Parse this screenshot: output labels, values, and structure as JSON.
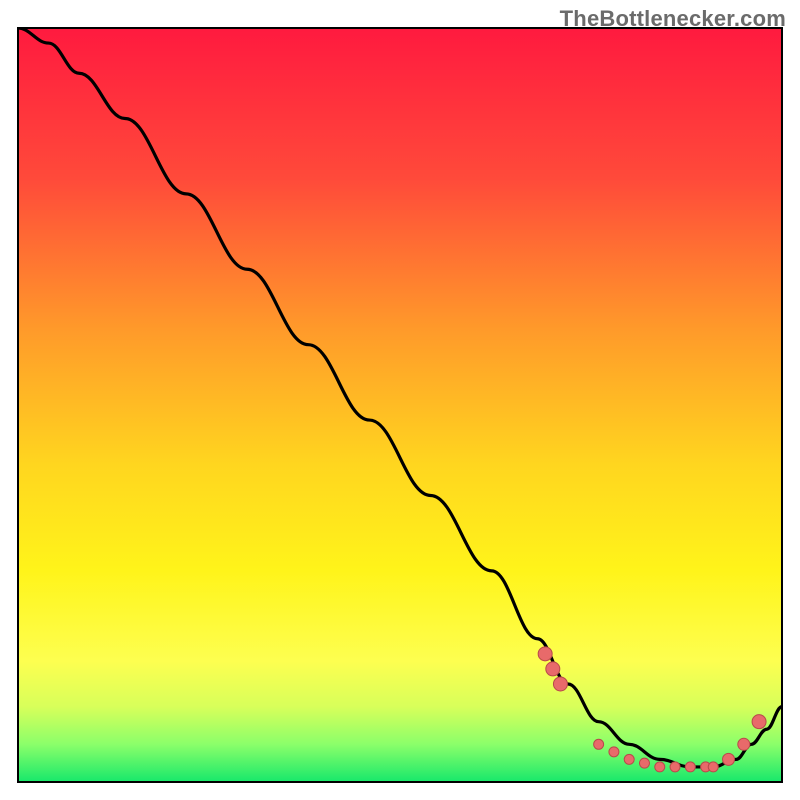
{
  "attribution": "TheBottlenecker.com",
  "chart_data": {
    "type": "line",
    "xlim": [
      0,
      100
    ],
    "ylim": [
      0,
      100
    ],
    "xlabel": "",
    "ylabel": "",
    "title": "",
    "gradient_stops": [
      {
        "offset": 0.0,
        "color": "#ff1a3f"
      },
      {
        "offset": 0.2,
        "color": "#ff4a3a"
      },
      {
        "offset": 0.4,
        "color": "#ff9a2a"
      },
      {
        "offset": 0.58,
        "color": "#ffd61f"
      },
      {
        "offset": 0.72,
        "color": "#fff41a"
      },
      {
        "offset": 0.84,
        "color": "#fdff50"
      },
      {
        "offset": 0.9,
        "color": "#d8ff5a"
      },
      {
        "offset": 0.95,
        "color": "#8bff6a"
      },
      {
        "offset": 1.0,
        "color": "#17e86b"
      }
    ],
    "series": [
      {
        "name": "bottleneck-curve",
        "color": "#000000",
        "x": [
          0,
          4,
          8,
          14,
          22,
          30,
          38,
          46,
          54,
          62,
          68,
          72,
          76,
          80,
          84,
          88,
          91,
          94,
          96,
          98,
          100
        ],
        "values": [
          100,
          98,
          94,
          88,
          78,
          68,
          58,
          48,
          38,
          28,
          19,
          13,
          8,
          5,
          3,
          2,
          2,
          3,
          5,
          7,
          10
        ]
      }
    ],
    "markers": {
      "name": "sweet-spot-dots",
      "color": "#e86a6a",
      "border": "#b84a4a",
      "x": [
        69,
        70,
        71,
        76,
        78,
        80,
        82,
        84,
        86,
        88,
        90,
        91,
        93,
        95,
        97
      ],
      "values": [
        17,
        15,
        13,
        5,
        4,
        3,
        2.5,
        2,
        2,
        2,
        2,
        2,
        3,
        5,
        8
      ],
      "sizes": [
        7,
        7,
        7,
        5,
        5,
        5,
        5,
        5,
        5,
        5,
        5,
        5,
        6,
        6,
        7
      ]
    }
  }
}
